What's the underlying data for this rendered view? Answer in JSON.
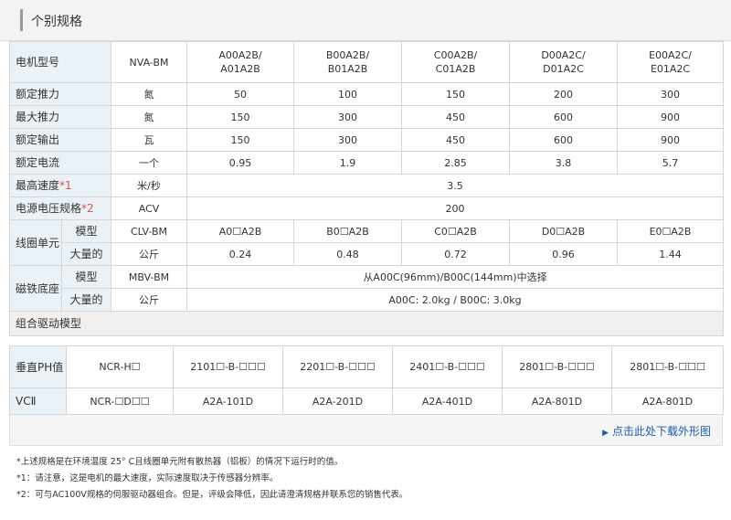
{
  "header": {
    "title": "个别规格"
  },
  "specs": {
    "motor_model_label": "电机型号",
    "motor_series": "NVA-BM",
    "models": [
      [
        "A00A2B/",
        "A01A2B"
      ],
      [
        "B00A2B/",
        "B01A2B"
      ],
      [
        "C00A2B/",
        "C01A2B"
      ],
      [
        "D00A2C/",
        "D01A2C"
      ],
      [
        "E00A2C/",
        "E01A2C"
      ]
    ],
    "rows": [
      {
        "label": "额定推力",
        "unit": "氮",
        "values": [
          "50",
          "100",
          "150",
          "200",
          "300"
        ]
      },
      {
        "label": "最大推力",
        "unit": "氮",
        "values": [
          "150",
          "300",
          "450",
          "600",
          "900"
        ]
      },
      {
        "label": "额定输出",
        "unit": "瓦",
        "values": [
          "150",
          "300",
          "450",
          "600",
          "900"
        ]
      },
      {
        "label": "额定电流",
        "unit": "一个",
        "values": [
          "0.95",
          "1.9",
          "2.85",
          "3.8",
          "5.7"
        ]
      }
    ],
    "max_speed": {
      "label": "最高速度",
      "note": "*1",
      "unit": "米/秒",
      "value": "3.5"
    },
    "voltage": {
      "label": "电源电压规格",
      "note": "*2",
      "unit": "ACV",
      "value": "200"
    },
    "coil": {
      "label": "线圈单元",
      "model_label": "模型",
      "model_code": "CLV-BM",
      "models": [
        "A0☐A2B",
        "B0☐A2B",
        "C0☐A2B",
        "D0☐A2B",
        "E0☐A2B"
      ],
      "mass_label": "大量的",
      "mass_unit": "公斤",
      "masses": [
        "0.24",
        "0.48",
        "0.72",
        "0.96",
        "1.44"
      ]
    },
    "magnet": {
      "label": "磁铁底座",
      "model_label": "模型",
      "model_code": "MBV-BM",
      "model_value": "从A00C(96mm)/B00C(144mm)中选择",
      "mass_label": "大量的",
      "mass_unit": "公斤",
      "mass_value": "A00C: 2.0kg / B00C: 3.0kg"
    },
    "combo_section": "组合驱动模型"
  },
  "combo": {
    "rows": [
      {
        "label": "垂直PH值",
        "code": "NCR-H☐",
        "values": [
          "2101☐-B-☐☐☐",
          "2201☐-B-☐☐☐",
          "2401☐-B-☐☐☐",
          "2801☐-B-☐☐☐",
          "2801☐-B-☐☐☐"
        ]
      },
      {
        "label": "VCⅡ",
        "code": "NCR-☐D☐☐",
        "values": [
          "A2A-101D",
          "A2A-201D",
          "A2A-401D",
          "A2A-801D",
          "A2A-801D"
        ]
      }
    ]
  },
  "link": {
    "text": "点击此处下载外形图"
  },
  "notes": [
    "*上述规格是在环境温度 25° C且线圈单元附有散热器（铝板）的情况下运行时的值。",
    "*1：请注意，这是电机的最大速度，实际速度取决于传感器分辨率。",
    "*2：可与AC100V规格的伺服驱动器组合。但是，评级会降低，因此请澄清规格并联系您的销售代表。"
  ],
  "colors": {
    "header_bg": "#f3f3f3",
    "label_bg": "#eaf1f7",
    "link": "#1a5ea8",
    "note_red": "#d9534f"
  }
}
